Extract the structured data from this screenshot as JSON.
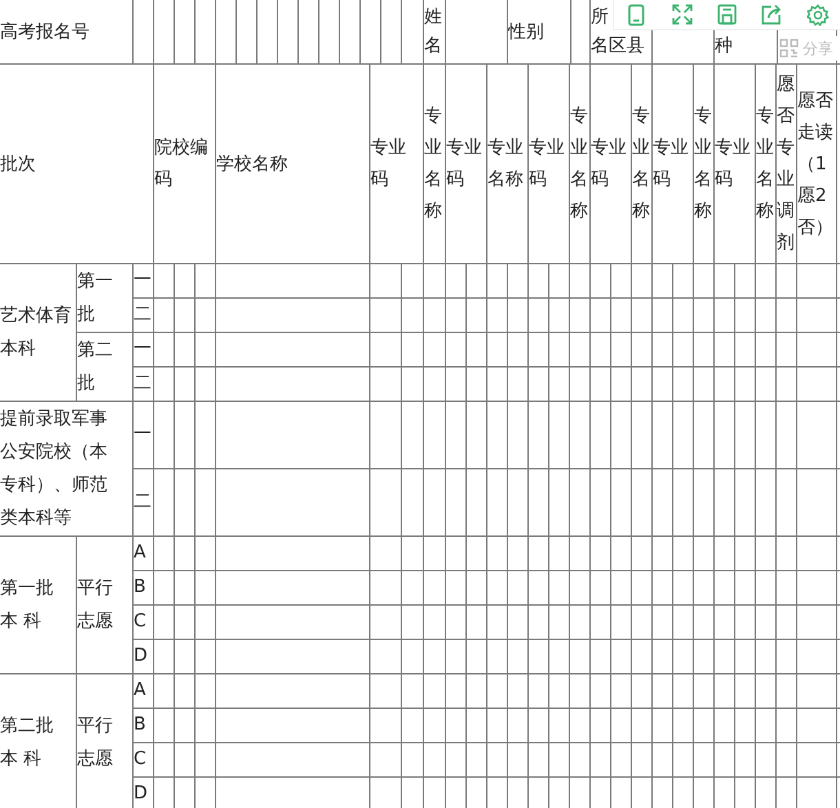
{
  "toolbar": {
    "share_label": "分享"
  },
  "header_row_1": {
    "registration_label": "高考报名号",
    "name_label": "姓名",
    "gender_label": "性别",
    "county_label_lines": [
      "所",
      "名区县"
    ],
    "column_10_label": "种"
  },
  "columns": [
    "批次",
    "院校编码",
    "学校名称",
    "专业码",
    "专业名称",
    "专业码",
    "专业名称",
    "专业码",
    "专业名称",
    "专业码",
    "专业名称",
    "专业码",
    "专业名称",
    "专业码",
    "专业名称",
    "愿否专业调剂",
    "愿否走读（1愿2否）"
  ],
  "groups": [
    {
      "kind": "split",
      "label": "艺术体育本科",
      "subgroups": [
        {
          "label": "第一批",
          "rows": [
            "一",
            "二"
          ]
        },
        {
          "label": "第二批",
          "rows": [
            "一",
            "二"
          ]
        }
      ]
    },
    {
      "kind": "wide",
      "label": "提前录取军事公安院校（本专科）、师范类本科等",
      "rows": [
        "一",
        "二"
      ]
    },
    {
      "kind": "split",
      "label_lines": [
        "第一批",
        "本 科"
      ],
      "subgroups": [
        {
          "label": "平行志愿",
          "rows": [
            "A",
            "B",
            "C",
            "D"
          ]
        }
      ]
    },
    {
      "kind": "split",
      "label_lines": [
        "第二批",
        "本 科"
      ],
      "subgroups": [
        {
          "label": "平行志愿",
          "rows": [
            "A",
            "B",
            "C",
            "D"
          ]
        }
      ]
    }
  ]
}
